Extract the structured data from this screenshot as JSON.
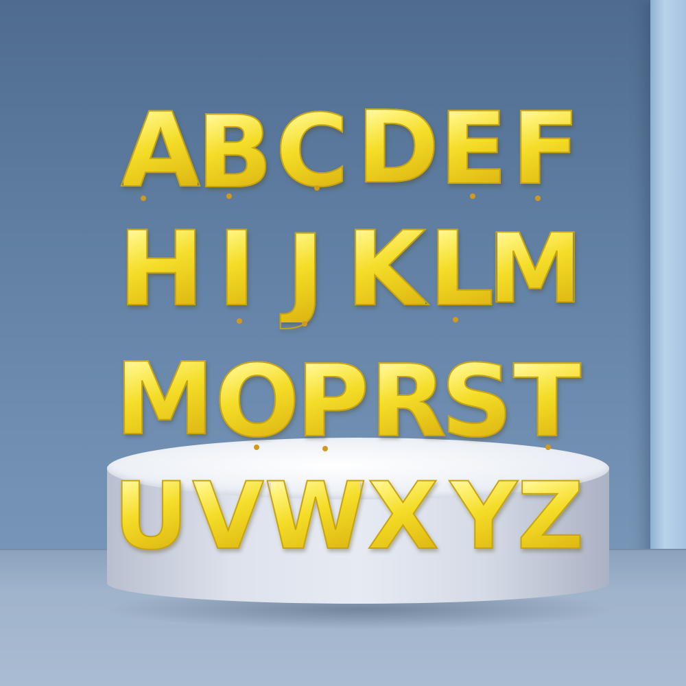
{
  "image": {
    "subject": "gold foil letter balloons on a white round podium",
    "background_color": "#5f7ea1",
    "podium_color": "#e6ebf3",
    "balloon_color": "#f4dd28"
  },
  "balloon_rows": [
    [
      "A",
      "B",
      "C",
      "D",
      "E",
      "F"
    ],
    [
      "H",
      "I",
      "J",
      "K",
      "L",
      "M"
    ],
    [
      "M",
      "O",
      "P",
      "R",
      "S",
      "T"
    ],
    [
      "U",
      "V",
      "W",
      "X",
      "Y",
      "Z"
    ]
  ]
}
